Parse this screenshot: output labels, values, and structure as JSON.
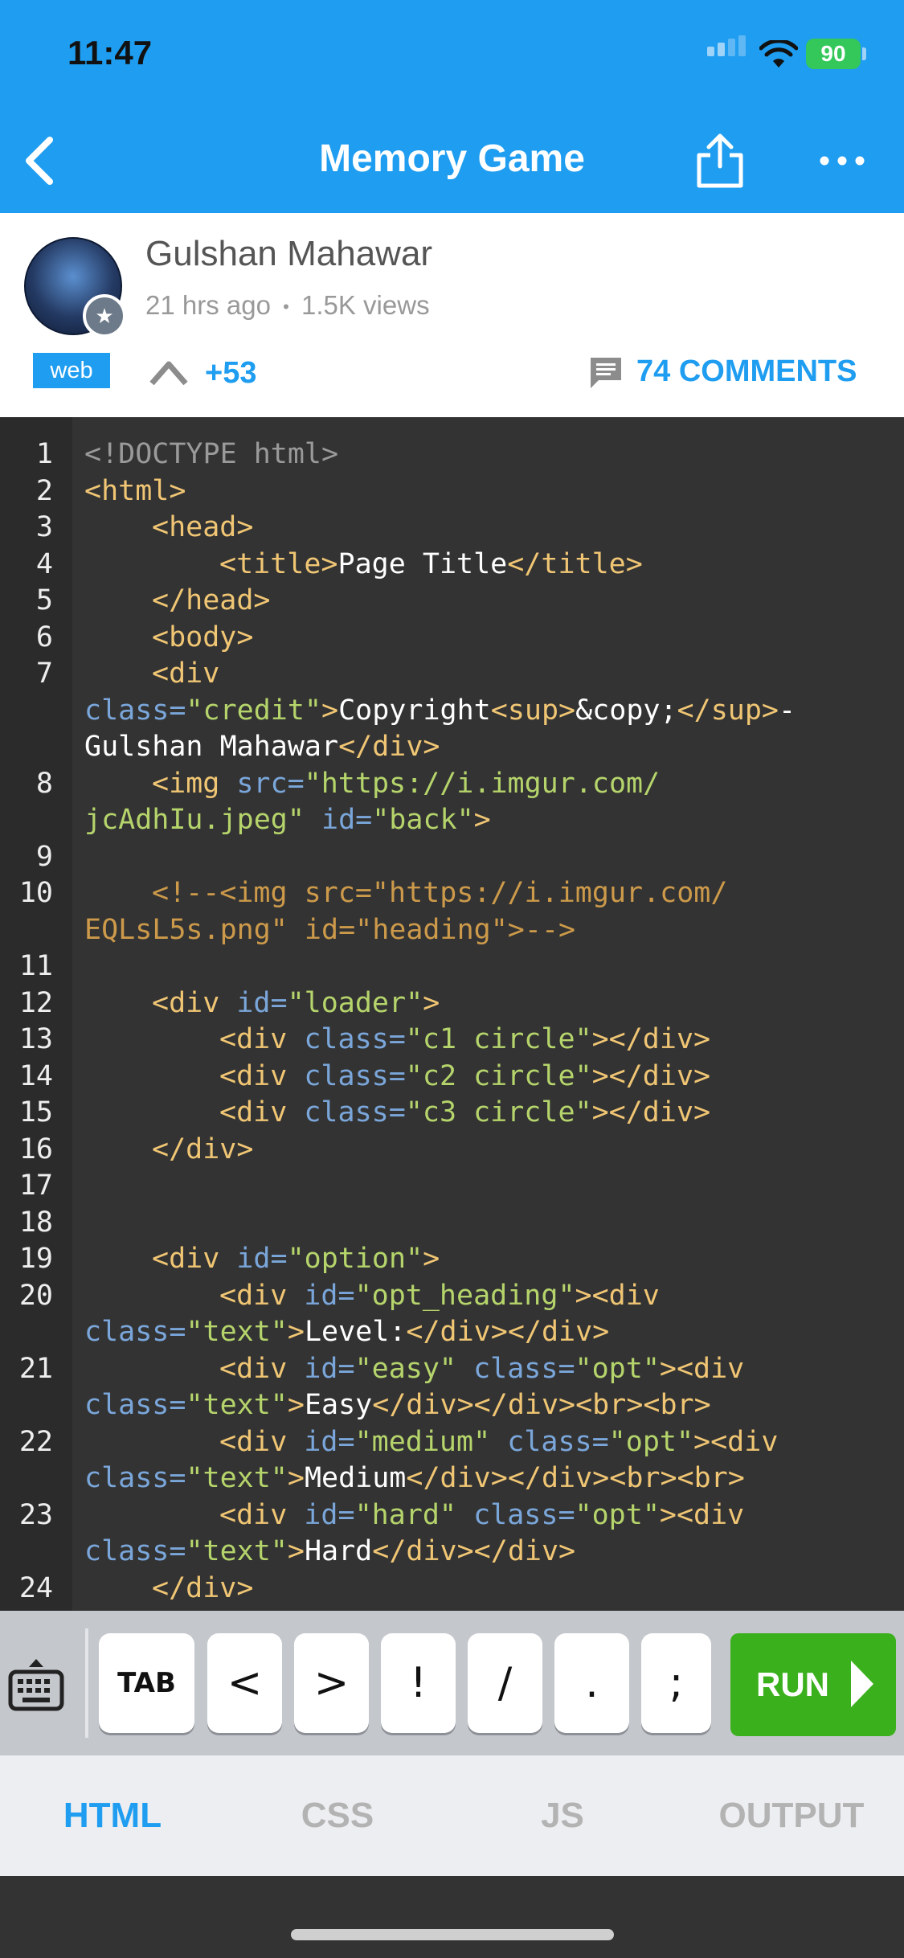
{
  "status_bar": {
    "time": "11:47",
    "battery": "90"
  },
  "app_bar": {
    "title": "Memory Game"
  },
  "post": {
    "author": "Gulshan Mahawar",
    "time_ago": "21 hrs ago",
    "views": "1.5K views",
    "meta_separator": "•",
    "tag": "web",
    "votes": "+53",
    "comments": "74 COMMENTS"
  },
  "code": {
    "line_numbers": [
      "1",
      "2",
      "3",
      "4",
      "5",
      "6",
      "7",
      "8",
      "9",
      "10",
      "11",
      "12",
      "13",
      "14",
      "15",
      "16",
      "17",
      "18",
      "19",
      "20",
      "21",
      "22",
      "23",
      "24"
    ],
    "l1": "<!DOCTYPE html>",
    "l2": "<html>",
    "l3": "<head>",
    "l4_open": "<title>",
    "l4_text": "Page Title",
    "l4_close": "</title>",
    "l5": "</head>",
    "l6": "<body>",
    "l7_open": "<div",
    "l7_attr": "class=",
    "l7_val": "\"credit\"",
    "l7_gt": ">",
    "l7_text": "Copyright",
    "l7_sup": "<sup>",
    "l7_ent": "&copy;",
    "l7_sup_close": "</sup>",
    "l7_dash": "-",
    "l7_text2": "Gulshan Mahawar",
    "l7_close": "</div>",
    "l8_open": "<img ",
    "l8_attr": "src=",
    "l8_val": "\"https://i.imgur.com/",
    "l8_val2": "jcAdhIu.jpeg\"",
    "l8_attr2": " id=",
    "l8_val3": "\"back\"",
    "l8_gt": ">",
    "l10a": "<!--<img src=\"https://i.imgur.com/",
    "l10b": "EQLsL5s.png\" id=\"heading\">-->",
    "l12_open": "<div ",
    "l12_attr": "id=",
    "l12_val": "\"loader\"",
    "l12_gt": ">",
    "l13_val": "\"c1 circle\"",
    "l14_val": "\"c2 circle\"",
    "l15_val": "\"c3 circle\"",
    "div_open": "<div ",
    "class_attr": "class=",
    "id_attr": "id=",
    "gt": ">",
    "div_close": "</div>",
    "close_pair": "></div>",
    "l19_val": "\"option\"",
    "l20_val": "\"opt_heading\"",
    "l20_tail": "><div",
    "text_val": "\"text\"",
    "l20_text": "Level:",
    "double_close": "</div></div>",
    "l21_val": "\"easy\"",
    "opt_val": "\"opt\"",
    "l21_text": "Easy",
    "br_tail": "</div></div><br><br>",
    "l22_val": "\"medium\"",
    "l22_text": "Medium",
    "l23_val": "\"hard\"",
    "l23_text": "Hard",
    "l24": "</div>"
  },
  "keyboard_bar": {
    "keys": [
      "TAB",
      "<",
      ">",
      "!",
      "/",
      ".",
      ";"
    ],
    "run_label": "RUN"
  },
  "tabs": [
    "HTML",
    "CSS",
    "JS",
    "OUTPUT"
  ],
  "colors": {
    "accent": "#1f9df0",
    "run_green": "#3bb01d",
    "editor_bg": "#333333"
  }
}
